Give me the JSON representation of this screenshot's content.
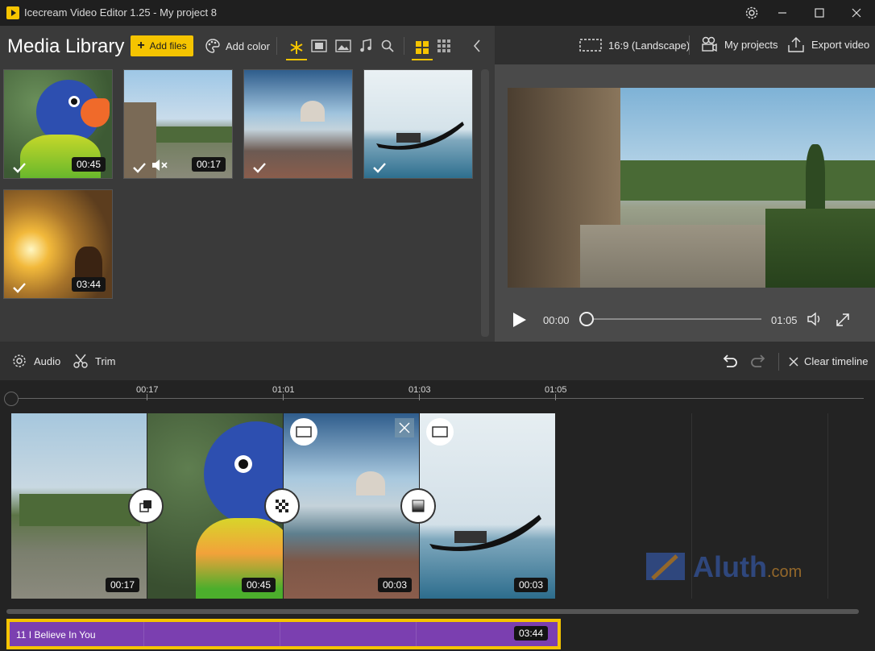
{
  "window": {
    "title": "Icecream Video Editor 1.25 - My project 8"
  },
  "library": {
    "title": "Media Library",
    "add_files": "Add files",
    "add_color": "Add color",
    "items": [
      {
        "duration": "00:45"
      },
      {
        "duration": "00:17"
      },
      {
        "duration": ""
      },
      {
        "duration": ""
      },
      {
        "duration": "03:44"
      }
    ]
  },
  "preview": {
    "aspect": "16:9 (Landscape)",
    "my_projects": "My projects",
    "export": "Export video",
    "time_current": "00:00",
    "time_total": "01:05",
    "progress": 0
  },
  "toolbar": {
    "audio": "Audio",
    "trim": "Trim",
    "clear": "Clear timeline"
  },
  "timeline": {
    "ruler": [
      "00:17",
      "01:01",
      "01:03",
      "01:05"
    ],
    "clips": [
      {
        "duration": "00:17"
      },
      {
        "duration": "00:45"
      },
      {
        "duration": "00:03"
      },
      {
        "duration": "00:03"
      }
    ],
    "audio": {
      "name": "11 I Believe In You",
      "duration": "03:44"
    }
  },
  "watermark": {
    "brand": "Aluth",
    "suffix": ".com"
  },
  "colors": {
    "accent": "#f5c400",
    "audio_track": "#7b3fb0"
  }
}
